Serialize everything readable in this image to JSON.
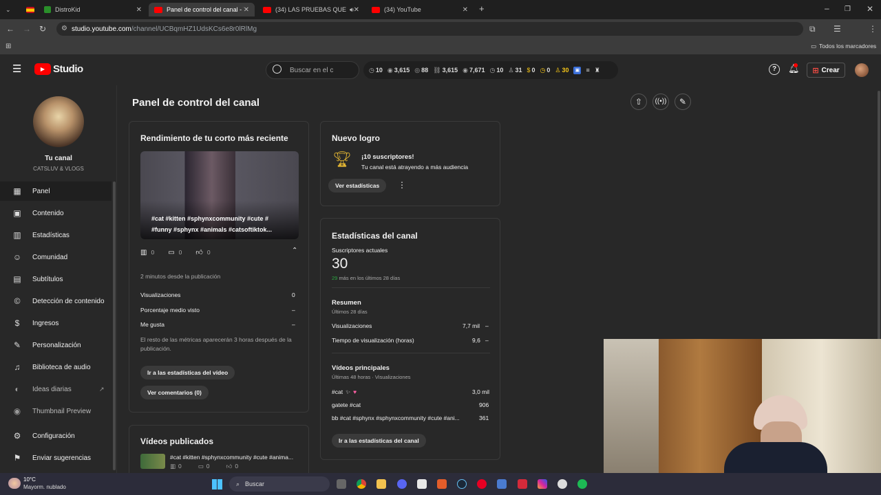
{
  "browser": {
    "tabs": [
      {
        "label": "DistroKid",
        "active": false
      },
      {
        "label": "Panel de control del canal - Yo",
        "active": true
      },
      {
        "label": "(34) LAS PRUEBAS QUE HA",
        "active": false
      },
      {
        "label": "(34) YouTube",
        "active": false
      }
    ],
    "url_host": "studio.youtube.com",
    "url_path": "/channel/UCBqmHZ1UdsKCs6e8r0lRlMg",
    "bookmarks_label": "Todos los marcadores"
  },
  "header": {
    "logo_text": "Studio",
    "search_placeholder": "Buscar en el c",
    "stats": [
      "10",
      "3,615",
      "88",
      "3,615",
      "7,671",
      "10",
      "31",
      "0",
      "0",
      "30"
    ],
    "create_label": "Crear"
  },
  "channel": {
    "title": "Tu canal",
    "subtitle": "CATSLUV & VLOGS"
  },
  "sidebar": {
    "items": [
      {
        "label": "Panel",
        "icon": "dashboard-icon"
      },
      {
        "label": "Contenido",
        "icon": "content-icon"
      },
      {
        "label": "Estadísticas",
        "icon": "analytics-icon"
      },
      {
        "label": "Comunidad",
        "icon": "community-icon"
      },
      {
        "label": "Subtítulos",
        "icon": "subtitles-icon"
      },
      {
        "label": "Detección de contenido",
        "icon": "copyright-icon"
      },
      {
        "label": "Ingresos",
        "icon": "earn-icon"
      },
      {
        "label": "Personalización",
        "icon": "customization-icon"
      },
      {
        "label": "Biblioteca de audio",
        "icon": "audio-library-icon"
      },
      {
        "label": "Ideas diarias",
        "icon": "ideas-icon"
      },
      {
        "label": "Thumbnail Preview",
        "icon": "thumbnail-icon"
      },
      {
        "label": "Configuración",
        "icon": "settings-icon"
      },
      {
        "label": "Enviar sugerencias",
        "icon": "feedback-icon"
      }
    ]
  },
  "page": {
    "title": "Panel de control del canal"
  },
  "short_card": {
    "title": "Rendimiento de tu corto más reciente",
    "caption_line1": "#cat #kitten #sphynxcommunity #cute #",
    "caption_line2": "#funny #sphynx #animals #catsoftiktok...",
    "views": "0",
    "comments": "0",
    "likes": "0",
    "time_since": "2 minutos desde la publicación",
    "metrics": [
      {
        "label": "Visualizaciones",
        "value": "0"
      },
      {
        "label": "Porcentaje medio visto",
        "value": "–"
      },
      {
        "label": "Me gusta",
        "value": "–"
      }
    ],
    "note": "El resto de las métricas aparecerán 3 horas después de la publicación.",
    "btn_stats": "Ir a las estadísticas del vídeo",
    "btn_comments": "Ver comentarios (0)"
  },
  "published_card": {
    "title": "Vídeos publicados",
    "item_title": "#cat #kitten #sphynxcommunity #cute #anima...",
    "views": "0",
    "comments": "0",
    "likes": "0"
  },
  "achievement_card": {
    "title": "Nuevo logro",
    "headline": "¡10 suscriptores!",
    "sub": "Tu canal está atrayendo a más audiencia",
    "btn": "Ver estadísticas"
  },
  "channel_stats": {
    "title": "Estadísticas del canal",
    "subs_label": "Suscriptores actuales",
    "subs_value": "30",
    "subs_delta_num": "29",
    "subs_delta_text": "más en los últimos 28 días",
    "summary_title": "Resumen",
    "summary_sub": "Últimos 28 días",
    "summary": [
      {
        "label": "Visualizaciones",
        "value": "7,7 mil",
        "trend": "–"
      },
      {
        "label": "Tiempo de visualización (horas)",
        "value": "9,6",
        "trend": "–"
      }
    ],
    "top_title": "Vídeos principales",
    "top_sub": "Últimas 48 horas · Visualizaciones",
    "top_videos": [
      {
        "label": "#cat",
        "value": "3,0 mil"
      },
      {
        "label": "gatete #cat",
        "value": "906"
      },
      {
        "label": "bb #cat #sphynx #sphynxcommunity #cute #ani...",
        "value": "361"
      }
    ],
    "btn": "Ir a las estadísticas del canal"
  },
  "taskbar": {
    "weather_temp": "10°C",
    "weather_desc": "Mayorm. nublado",
    "search_label": "Buscar"
  }
}
